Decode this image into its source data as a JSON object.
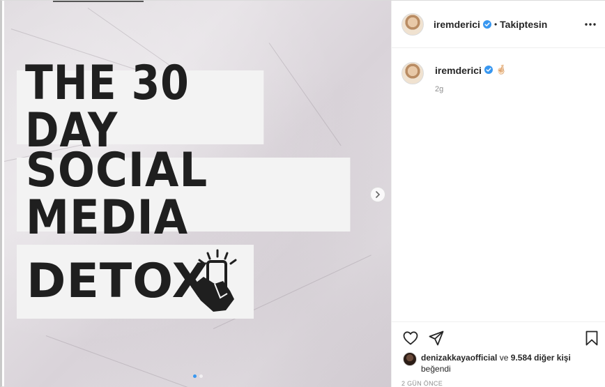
{
  "post": {
    "image": {
      "line1": "THE 30 DAY",
      "line2": "SOCIAL MEDIA",
      "line3": "DETOX",
      "carousel_dots": 2,
      "active_dot": 0
    }
  },
  "header": {
    "username": "iremderici",
    "separator": "•",
    "follow_status": "Takiptesin"
  },
  "caption": {
    "username": "iremderici",
    "emoji": "🤞🏻",
    "time": "2g"
  },
  "likes": {
    "user": "denizakkaya official",
    "user_display": "denizakkayaofficial",
    "connector": "ve",
    "others": "9.584 diğer kişi",
    "suffix": "beğendi"
  },
  "date": "2 GÜN ÖNCE",
  "colors": {
    "verified": "#3897f0",
    "text": "#262626",
    "muted": "#8e8e8e",
    "border": "#efefef"
  },
  "icons": [
    "verified-badge-icon",
    "more-options-icon",
    "heart-icon",
    "share-icon",
    "bookmark-icon",
    "chevron-right-icon",
    "phone-tap-icon"
  ]
}
